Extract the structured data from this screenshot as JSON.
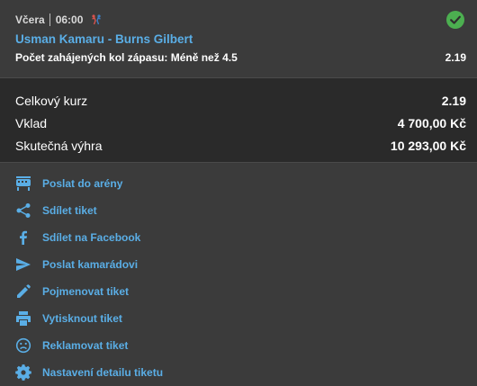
{
  "ticket": {
    "day": "Včera",
    "time": "06:00",
    "sport_icon": "sport-icon",
    "status_icon": "check-circle-icon",
    "match": "Usman Kamaru - Burns Gilbert",
    "market": "Počet zahájených kol zápasu: Méně než 4.5",
    "odds": "2.19"
  },
  "summary": {
    "total_odds_label": "Celkový kurz",
    "total_odds_value": "2.19",
    "stake_label": "Vklad",
    "stake_value": "4 700,00 Kč",
    "win_label": "Skutečná výhra",
    "win_value": "10 293,00 Kč"
  },
  "actions": [
    {
      "label": "Poslat do arény",
      "icon": "arena-icon"
    },
    {
      "label": "Sdílet tiket",
      "icon": "share-icon"
    },
    {
      "label": "Sdílet na Facebook",
      "icon": "facebook-icon"
    },
    {
      "label": "Poslat kamarádovi",
      "icon": "send-icon"
    },
    {
      "label": "Pojmenovat tiket",
      "icon": "pencil-icon"
    },
    {
      "label": "Vytisknout tiket",
      "icon": "print-icon"
    },
    {
      "label": "Reklamovat tiket",
      "icon": "sad-face-icon"
    },
    {
      "label": "Nastavení detailu tiketu",
      "icon": "gear-icon"
    }
  ],
  "colors": {
    "accent": "#5aaee6",
    "success": "#4caf50",
    "background": "#3b3b3b",
    "summary_background": "#2a2a2a"
  }
}
